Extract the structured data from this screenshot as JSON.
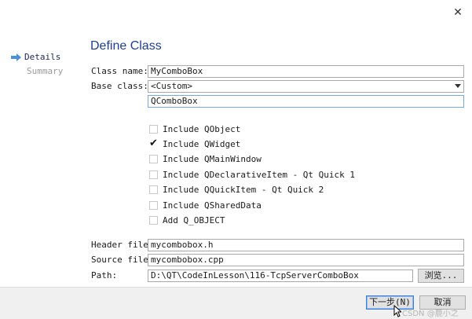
{
  "window": {
    "close_glyph": "✕"
  },
  "sidebar": {
    "items": [
      {
        "label": "Details",
        "active": true
      },
      {
        "label": "Summary",
        "active": false
      }
    ]
  },
  "page_title": "Define Class",
  "form": {
    "class_name_label": "Class name:",
    "class_name_value": "MyComboBox",
    "base_class_label": "Base class:",
    "base_class_value": "<Custom>",
    "custom_base_value": "QComboBox",
    "header_file_label": "Header file:",
    "header_file_value": "mycombobox.h",
    "source_file_label": "Source file:",
    "source_file_value": "mycombobox.cpp",
    "path_label": "Path:",
    "path_value": "D:\\QT\\CodeInLesson\\116-TcpServerComboBox",
    "browse_label": "浏览..."
  },
  "options": [
    {
      "label": "Include QObject",
      "checked": false
    },
    {
      "label": "Include QWidget",
      "checked": true
    },
    {
      "label": "Include QMainWindow",
      "checked": false
    },
    {
      "label": "Include QDeclarativeItem - Qt Quick 1",
      "checked": false
    },
    {
      "label": "Include QQuickItem - Qt Quick 2",
      "checked": false
    },
    {
      "label": "Include QSharedData",
      "checked": false
    },
    {
      "label": "Add Q_OBJECT",
      "checked": false
    }
  ],
  "footer": {
    "next_label": "下一步(N)",
    "cancel_label": "取消"
  },
  "watermark": "CSDN @鹿小之",
  "colors": {
    "accent": "#1f3f8f",
    "arrow": "#4a90d9",
    "default_button_border": "#3c7fd6"
  },
  "icons": {
    "close": "close-icon",
    "active_step": "right-arrow-icon",
    "dropdown": "chevron-down-icon",
    "check": "check-icon"
  }
}
